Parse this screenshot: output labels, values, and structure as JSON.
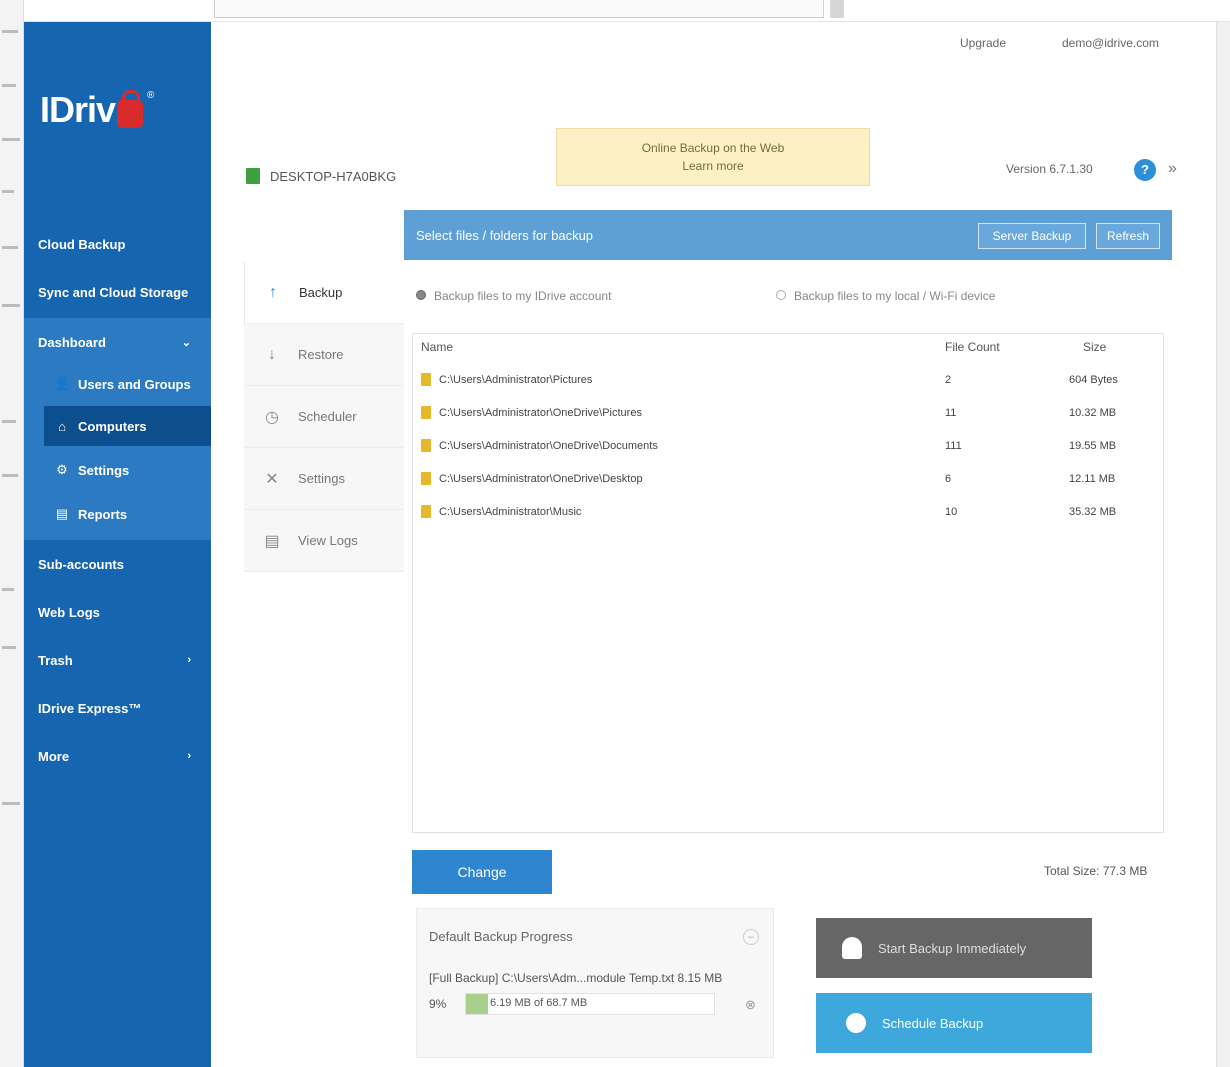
{
  "brand": {
    "logo_text": "IDriv",
    "tm": "®"
  },
  "header": {
    "upgrade": "Upgrade",
    "account": "demo@idrive.com",
    "notice_line1": "Online Backup on the Web",
    "notice_line2": "Learn more",
    "computer_name": "DESKTOP-H7A0BKG",
    "version": "Version 6.7.1.30",
    "more": "»"
  },
  "sidebar": {
    "items": [
      {
        "label": "Cloud Backup"
      },
      {
        "label": "Sync and Cloud Storage"
      },
      {
        "label": "Dashboard",
        "caret": "⌄"
      },
      {
        "label": "Sub-accounts"
      },
      {
        "label": "Web Logs"
      },
      {
        "label": "Trash",
        "caret": "›"
      },
      {
        "label": "IDrive Express™"
      },
      {
        "label": "More",
        "caret": "›"
      }
    ],
    "sub_items": [
      {
        "label": "Users and Groups",
        "icon": "👤"
      },
      {
        "label": "Computers",
        "icon": "⌂"
      },
      {
        "label": "Settings",
        "icon": "⚙"
      },
      {
        "label": "Reports",
        "icon": "▤"
      }
    ]
  },
  "tabs": [
    {
      "label": "Backup",
      "icon": "↑"
    },
    {
      "label": "Restore",
      "icon": "↓"
    },
    {
      "label": "Scheduler",
      "icon": "◷"
    },
    {
      "label": "Settings",
      "icon": "✕"
    },
    {
      "label": "View Logs",
      "icon": "▤"
    }
  ],
  "panel": {
    "title": "Select files / folders for backup",
    "btn_server": "Server Backup",
    "btn_refresh": "Refresh",
    "dest_idrive": "Backup files to my IDrive account",
    "dest_local": "Backup files to my local / Wi-Fi device"
  },
  "table": {
    "columns": [
      "Name",
      "File Count",
      "Size"
    ],
    "rows": [
      {
        "name": "C:\\Users\\Administrator\\Pictures",
        "count": "2",
        "size": "604 Bytes"
      },
      {
        "name": "C:\\Users\\Administrator\\OneDrive\\Pictures",
        "count": "11",
        "size": "10.32 MB"
      },
      {
        "name": "C:\\Users\\Administrator\\OneDrive\\Documents",
        "count": "111",
        "size": "19.55 MB"
      },
      {
        "name": "C:\\Users\\Administrator\\OneDrive\\Desktop",
        "count": "6",
        "size": "12.11 MB"
      },
      {
        "name": "C:\\Users\\Administrator\\Music",
        "count": "10",
        "size": "35.32 MB"
      }
    ]
  },
  "footer": {
    "change_label": "Change",
    "total_size": "Total Size: 77.3 MB"
  },
  "progress": {
    "title": "Default Backup Progress",
    "minimize": "–",
    "line": "[Full Backup] C:\\Users\\Adm...module Temp.txt 8.15 MB",
    "percent": "9%",
    "fraction": 0.09,
    "bar_text": "6.19 MB of 68.7 MB",
    "stop": "⊗"
  },
  "actions": {
    "backup_now": "Start Backup Immediately",
    "schedule": "Schedule Backup"
  }
}
